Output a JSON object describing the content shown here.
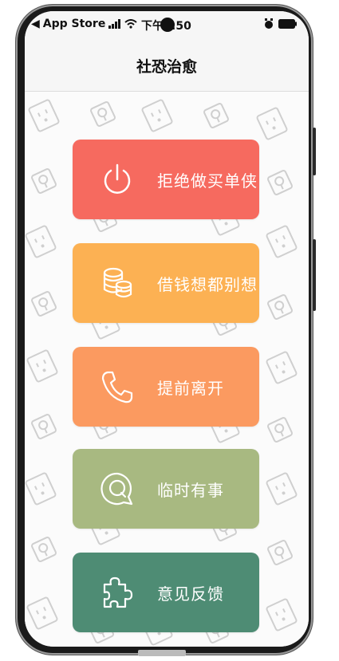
{
  "status_bar": {
    "back_label": "App Store",
    "time": "下午3:50"
  },
  "nav": {
    "title": "社恐治愈"
  },
  "cards": [
    {
      "label": "拒绝做买单侠",
      "color": "#f66a5f",
      "icon": "power-icon"
    },
    {
      "label": "借钱想都别想",
      "color": "#fcb153",
      "icon": "coins-icon"
    },
    {
      "label": "提前离开",
      "color": "#fb9a60",
      "icon": "phone-icon"
    },
    {
      "label": "临时有事",
      "color": "#a8b981",
      "icon": "chat-icon"
    },
    {
      "label": "意见反馈",
      "color": "#4e8c74",
      "icon": "puzzle-icon"
    }
  ]
}
